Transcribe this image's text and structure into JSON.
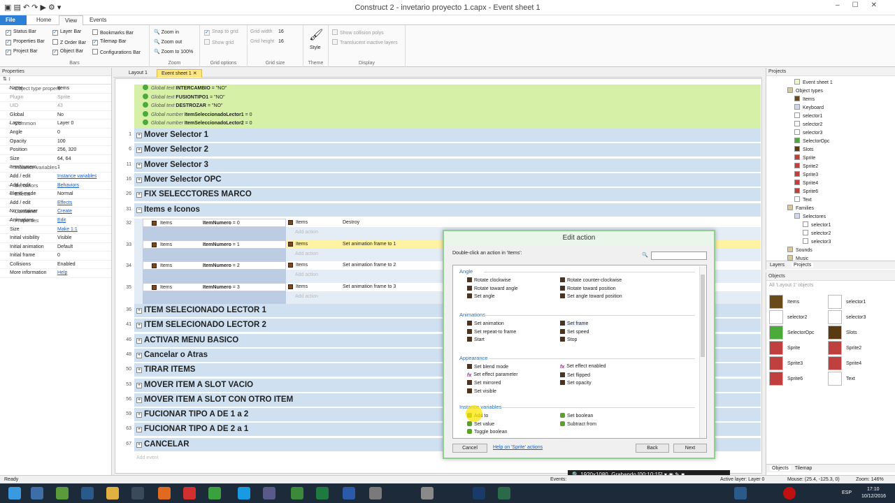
{
  "window": {
    "title": "Construct 2 - invetario proyecto 1.capx - Event sheet 1"
  },
  "ribbon": {
    "tabs": [
      "File",
      "Home",
      "View",
      "Events"
    ],
    "bars": {
      "status_bar": "Status Bar",
      "properties_bar": "Properties Bar",
      "project_bar": "Project Bar",
      "layer_bar": "Layer Bar",
      "z_order_bar": "Z Order Bar",
      "object_bar": "Object Bar",
      "bookmarks_bar": "Bookmarks Bar",
      "tilemap_bar": "Tilemap Bar",
      "configurations_bar": "Configurations Bar",
      "label": "Bars"
    },
    "zoom": {
      "zoom_in": "Zoom in",
      "zoom_out": "Zoom out",
      "zoom_100": "Zoom to 100%",
      "label": "Zoom"
    },
    "grid": {
      "snap": "Snap to grid",
      "show": "Show grid",
      "label": "Grid options"
    },
    "grid_size": {
      "width_label": "Grid width",
      "width": "16",
      "height_label": "Grid height",
      "height": "16",
      "label": "Grid size"
    },
    "theme": {
      "style": "Style",
      "label": "Theme"
    },
    "display": {
      "collision": "Show collision polys",
      "translucent": "Translucent inactive layers",
      "label": "Display"
    }
  },
  "properties": {
    "title": "Properties",
    "rows": [
      {
        "k": "Object type properties",
        "v": "",
        "type": "cat"
      },
      {
        "k": "Name",
        "v": "Items"
      },
      {
        "k": "Plugin",
        "v": "Sprite",
        "type": "dis"
      },
      {
        "k": "UID",
        "v": "43",
        "type": "dis"
      },
      {
        "k": "Global",
        "v": "No"
      },
      {
        "k": "Common",
        "v": "",
        "type": "cat"
      },
      {
        "k": "Layer",
        "v": "Layer 0"
      },
      {
        "k": "Angle",
        "v": "0"
      },
      {
        "k": "Opacity",
        "v": "100"
      },
      {
        "k": "Position",
        "v": "256, 320"
      },
      {
        "k": "Size",
        "v": "64, 64"
      },
      {
        "k": "Instance variables",
        "v": "",
        "type": "cat"
      },
      {
        "k": "ItemNumero",
        "v": "1"
      },
      {
        "k": "Add / edit",
        "v": "Instance variables",
        "type": "link"
      },
      {
        "k": "Behaviors",
        "v": "",
        "type": "cat"
      },
      {
        "k": "Add / edit",
        "v": "Behaviors",
        "type": "link"
      },
      {
        "k": "Effects",
        "v": "",
        "type": "cat"
      },
      {
        "k": "Blend mode",
        "v": "Normal"
      },
      {
        "k": "Add / edit",
        "v": "Effects",
        "type": "link"
      },
      {
        "k": "Container",
        "v": "",
        "type": "cat"
      },
      {
        "k": "No container",
        "v": "Create",
        "type": "link"
      },
      {
        "k": "Properties",
        "v": "",
        "type": "cat"
      },
      {
        "k": "Animations",
        "v": "Edit",
        "type": "link"
      },
      {
        "k": "Size",
        "v": "Make 1:1",
        "type": "link"
      },
      {
        "k": "Initial visibility",
        "v": "Visible"
      },
      {
        "k": "Initial animation",
        "v": "Default"
      },
      {
        "k": "Initial frame",
        "v": "0"
      },
      {
        "k": "Collisions",
        "v": "Enabled"
      },
      {
        "k": "More information",
        "v": "Help",
        "type": "link"
      }
    ]
  },
  "doc_tabs": [
    "Layout 1",
    "Event sheet 1"
  ],
  "globals": [
    {
      "t": "Global text",
      "n": "INTERCAMBIO",
      "v": "= \"NO\""
    },
    {
      "t": "Global text",
      "n": "FUSIONTIPO1",
      "v": "= \"NO\""
    },
    {
      "t": "Global text",
      "n": "DESTROZAR",
      "v": "= \"NO\""
    },
    {
      "t": "Global number",
      "n": "ItemSeleccionadoLector1",
      "v": "= 0"
    },
    {
      "t": "Global number",
      "n": "ItemSeleccionadoLector2",
      "v": "= 0"
    }
  ],
  "groups_top": [
    {
      "num": "1",
      "name": "Mover Selector 1"
    },
    {
      "num": "6",
      "name": "Mover Selector 2"
    },
    {
      "num": "11",
      "name": "Mover Selector 3"
    },
    {
      "num": "16",
      "name": "Mover Selector OPC"
    },
    {
      "num": "26",
      "name": "FIX SELECCTORES MARCO"
    },
    {
      "num": "31",
      "name": "Items e Iconos"
    }
  ],
  "events": [
    {
      "num": "32",
      "obj": "Items",
      "cond": "ItemNumero",
      "cval": "= 0",
      "aobj": "Items",
      "act": "Destroy"
    },
    {
      "num": "33",
      "obj": "Items",
      "cond": "ItemNumero",
      "cval": "= 1",
      "aobj": "Items",
      "act": "Set animation frame to 1"
    },
    {
      "num": "34",
      "obj": "Items",
      "cond": "ItemNumero",
      "cval": "= 2",
      "aobj": "Items",
      "act": "Set animation frame to 2"
    },
    {
      "num": "35",
      "obj": "Items",
      "cond": "ItemNumero",
      "cval": "= 3",
      "aobj": "Items",
      "act": "Set animation frame to 3"
    }
  ],
  "add_action": "Add action",
  "groups_bottom": [
    {
      "num": "36",
      "name": "ITEM SELECIONADO LECTOR 1"
    },
    {
      "num": "41",
      "name": "ITEM SELECIONADO LECTOR 2"
    },
    {
      "num": "46",
      "name": "ACTIVAR MENU BASICO"
    },
    {
      "num": "48",
      "name": "Cancelar o Atras"
    },
    {
      "num": "50",
      "name": "TIRAR ITEMS"
    },
    {
      "num": "53",
      "name": "MOVER ITEM A SLOT VACIO"
    },
    {
      "num": "56",
      "name": "MOVER ITEM A SLOT CON OTRO ITEM"
    },
    {
      "num": "59",
      "name": "FUCIONAR TIPO A  DE 1 a 2"
    },
    {
      "num": "63",
      "name": "FUCIONAR TIPO A  DE 2 a 1"
    },
    {
      "num": "67",
      "name": "CANCELAR"
    }
  ],
  "add_event": "Add event",
  "projects": {
    "title": "Projects",
    "tree": [
      "Event sheet 1",
      "Object types",
      "Items",
      "Keyboard",
      "selector1",
      "selector2",
      "selector3",
      "SelectorOpc",
      "Slots",
      "Sprite",
      "Sprite2",
      "Sprite3",
      "Sprite4",
      "Sprite6",
      "Text",
      "Families",
      "Selectores",
      "selector1",
      "selector2",
      "selector3",
      "Sounds",
      "Music"
    ],
    "tabs": [
      "Layers",
      "Projects"
    ]
  },
  "objects": {
    "title": "Objects",
    "filter": "All 'Layout 1' objects",
    "items": [
      "Items",
      "selector1",
      "selector2",
      "selector3",
      "SelectorOpc",
      "Slots",
      "Sprite",
      "Sprite2",
      "Sprite3",
      "Sprite4",
      "Sprite6",
      "Text"
    ],
    "tabs": [
      "Objects",
      "Tilemap"
    ]
  },
  "dialog": {
    "title": "Edit action",
    "hint": "Double-click an action in 'Items':",
    "categories": [
      {
        "name": "Angle",
        "items": [
          "Rotate clockwise",
          "Rotate counter-clockwise",
          "Rotate toward angle",
          "Rotate toward position",
          "Set angle",
          "Set angle toward position"
        ]
      },
      {
        "name": "Animations",
        "items": [
          "Set animation",
          "Set frame",
          "Set repeat-to frame",
          "Set speed",
          "Start",
          "Stop"
        ]
      },
      {
        "name": "Appearance",
        "items": [
          "Set blend mode",
          "Set effect enabled",
          "Set effect parameter",
          "Set flipped",
          "Set mirrored",
          "Set opacity",
          "Set visible"
        ]
      },
      {
        "name": "Instance variables",
        "items": [
          "Add to",
          "Set boolean",
          "Set value",
          "Subtract from",
          "Toggle boolean"
        ]
      }
    ],
    "cancel": "Cancel",
    "help": "Help on 'Sprite' actions",
    "back": "Back",
    "next": "Next"
  },
  "status": {
    "ready": "Ready",
    "events": "Events:",
    "layer": "Active layer: Layer 0",
    "mouse": "Mouse: (25.4, -125.3, 0)",
    "zoom": "Zoom: 146%"
  },
  "recording": {
    "res": "1920x1080",
    "label": "Grabando [00:10:15]"
  },
  "taskbar": {
    "lang": "ESP",
    "time": "17:10",
    "date": "10/12/2016"
  }
}
